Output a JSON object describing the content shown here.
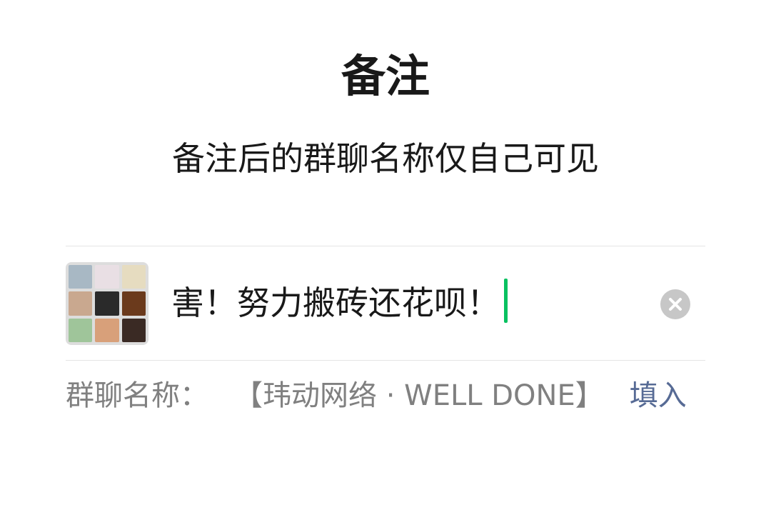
{
  "header": {
    "title": "备注",
    "subtitle": "备注后的群聊名称仅自己可见"
  },
  "remark_input": {
    "value": "害！努力搬砖还花呗！",
    "clear_icon": "clear-icon"
  },
  "group_avatar": {
    "icon": "group-avatar-grid",
    "tile_colors": [
      "#a8b8c4",
      "#e9dfe4",
      "#e6dcc0",
      "#c9a88f",
      "#2a2a2a",
      "#6b3a1c",
      "#9fc59a",
      "#d8a07a",
      "#3a2a24"
    ]
  },
  "group_name_row": {
    "label": "群聊名称：",
    "name": "【玮动网络 · WELL DONE】",
    "fill_link": "填入"
  },
  "colors": {
    "caret": "#07c160",
    "link": "#576b95",
    "secondary_text": "#808080"
  }
}
